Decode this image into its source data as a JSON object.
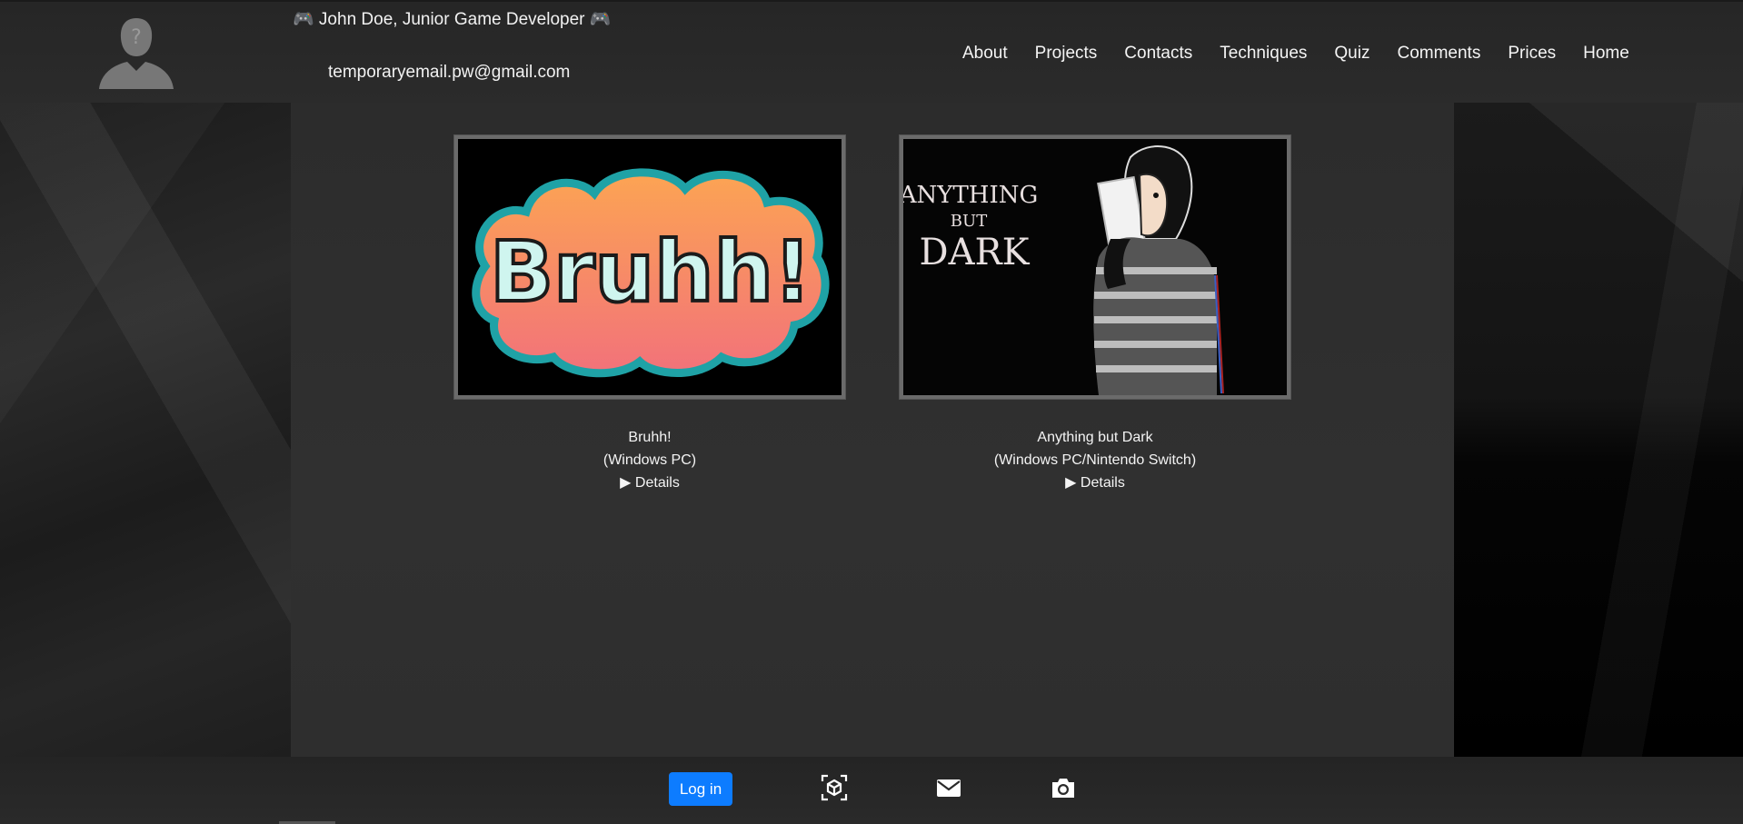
{
  "header": {
    "title": "🎮 John Doe, Junior Game Developer 🎮",
    "email": "temporaryemail.pw@gmail.com",
    "avatar_icon": "unknown-user-icon",
    "nav": [
      {
        "label": "About"
      },
      {
        "label": "Projects"
      },
      {
        "label": "Contacts"
      },
      {
        "label": "Techniques"
      },
      {
        "label": "Quiz"
      },
      {
        "label": "Comments"
      },
      {
        "label": "Prices"
      },
      {
        "label": "Home"
      }
    ]
  },
  "projects": [
    {
      "name": "Bruhh!",
      "platform": "(Windows PC)",
      "details": "▶ Details",
      "art_text": "Bruhh!"
    },
    {
      "name": "Anything but Dark",
      "platform": "(Windows PC/Nintendo Switch)",
      "details": "▶ Details",
      "art_text_line1": "ANYTHING",
      "art_text_line2": "BUT",
      "art_text_line3": "DARK"
    }
  ],
  "footer": {
    "login_label": "Log in",
    "icons": [
      "cube-icon",
      "mail-icon",
      "camera-icon"
    ]
  },
  "colors": {
    "accent": "#0d7cff",
    "background": "#2c2c2c"
  }
}
